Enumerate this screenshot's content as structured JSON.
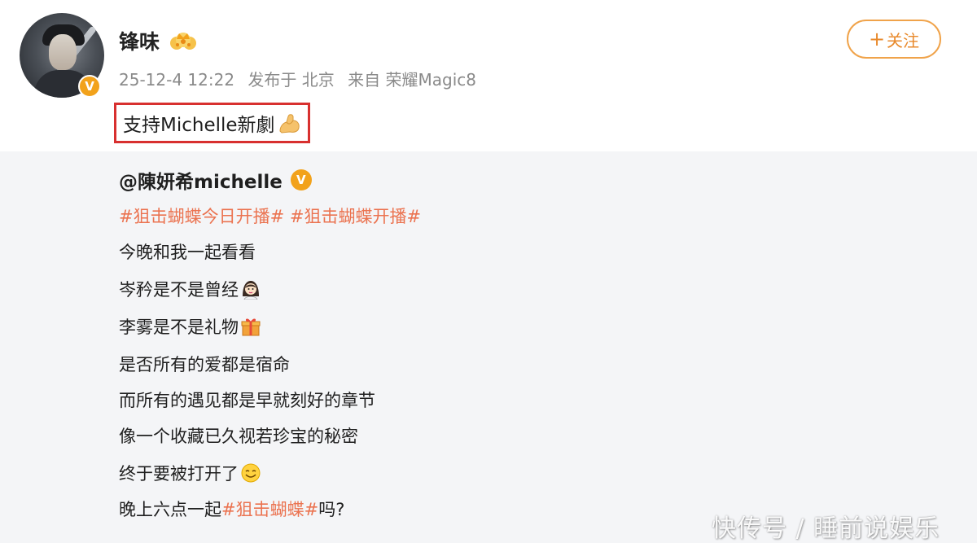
{
  "post": {
    "username": "锋味",
    "timestamp": "25-12-4 12:22",
    "location": "发布于 北京",
    "device": "来自 荣耀Magic8",
    "follow_label": "关注",
    "text": "支持Michelle新劇",
    "verified_badge": "V"
  },
  "repost": {
    "author": "@陳妍希michelle",
    "hashtags": "#狙击蝴蝶今日开播# #狙击蝴蝶开播#",
    "lines": [
      "今晚和我一起看看",
      "岑矜是不是曾经",
      "李雾是不是礼物",
      "是否所有的爱都是宿命",
      "而所有的遇见都是早就刻好的章节",
      "像一个收藏已久视若珍宝的秘密",
      "终于要被打开了"
    ],
    "last_line": {
      "prefix": "晚上六点一起",
      "hashtag": "#狙击蝴蝶#",
      "suffix": "吗?"
    }
  },
  "watermark": "快传号 / 睡前说娱乐",
  "colors": {
    "accent_orange": "#eb7350",
    "follow_border": "#f0a34a",
    "highlight_box": "#d8302f",
    "meta_gray": "#8a8a8a",
    "repost_bg": "#f4f5f7"
  },
  "icons": {
    "crown": "crown-icon",
    "muscle": "flexed-biceps-emoji",
    "woman": "woman-emoji",
    "gift": "gift-emoji",
    "smile": "smiling-face-emoji",
    "verified": "verified-v-badge-icon"
  }
}
